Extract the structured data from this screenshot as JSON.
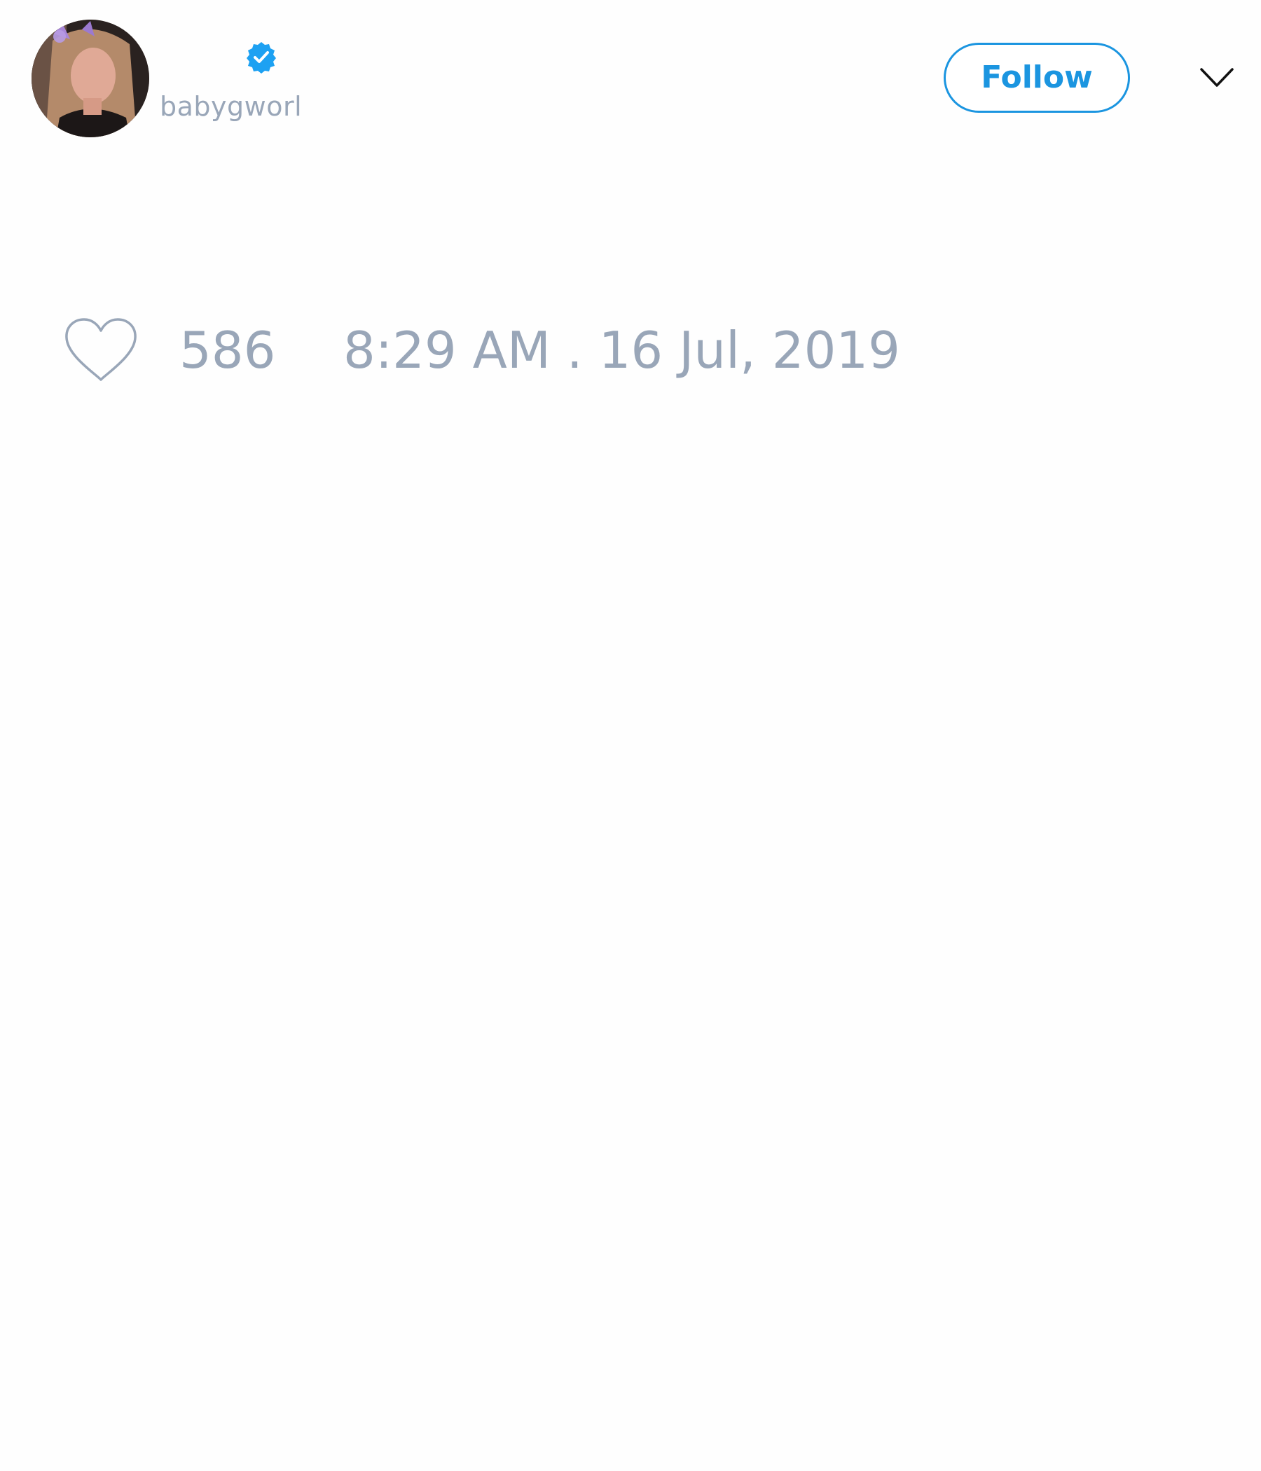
{
  "tweet": {
    "author": {
      "username": "babygworl",
      "avatar_icon": "profile-photo",
      "verified_icon": "verified-badge-icon",
      "verified_color": "#1da1f2"
    },
    "follow_label": "Follow",
    "menu_icon": "chevron-down-icon",
    "like_icon": "heart-outline-icon",
    "like_count": "586",
    "timestamp": "8:29 AM . 16 Jul, 2019"
  },
  "colors": {
    "accent": "#1b95e0",
    "muted_text": "#99a6b8",
    "background": "#fefefe"
  }
}
